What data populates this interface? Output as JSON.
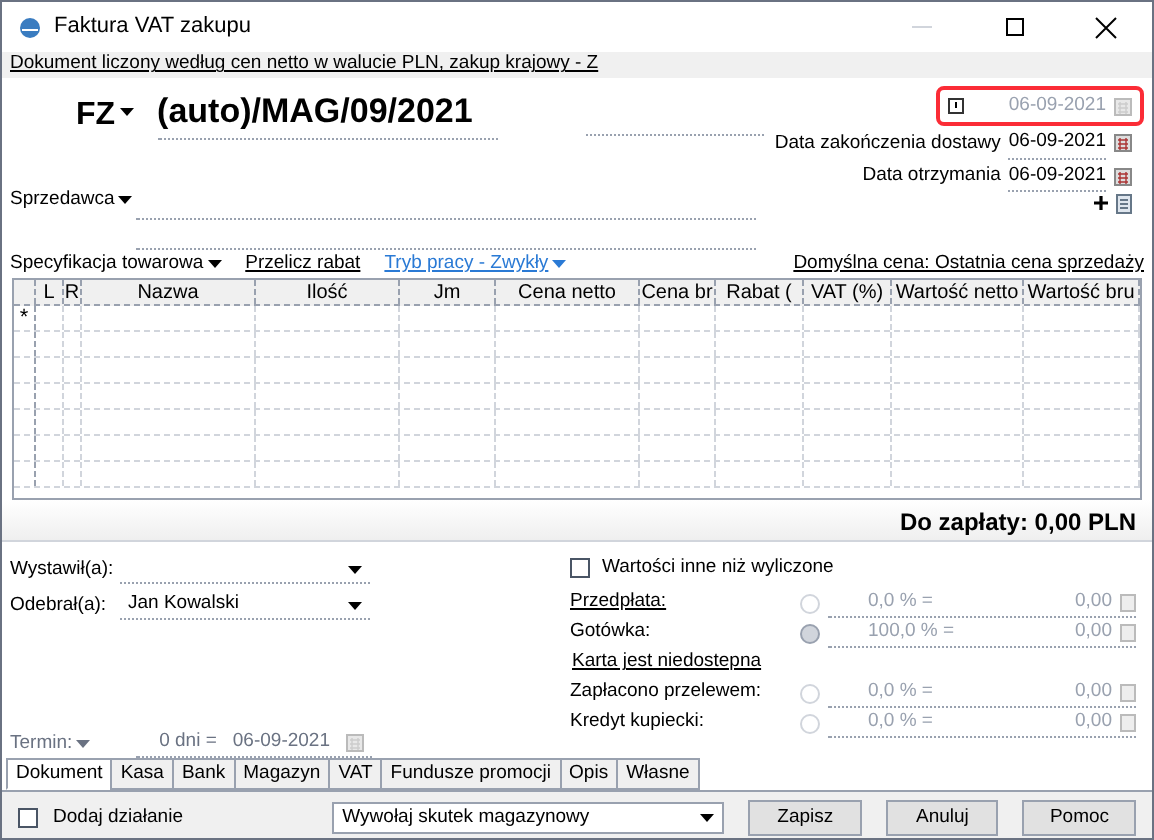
{
  "window": {
    "title": "Faktura VAT zakupu"
  },
  "info_link": "Dokument liczony według cen netto w walucie PLN, zakup krajowy - Z",
  "header": {
    "doc_type": "FZ",
    "number": "(auto)/MAG/09/2021",
    "issue_date": {
      "value": "06-09-2021",
      "disabled": true,
      "highlighted": true
    },
    "dates": [
      {
        "label": "Data zakończenia dostawy",
        "value": "06-09-2021"
      },
      {
        "label": "Data otrzymania",
        "value": "06-09-2021"
      }
    ],
    "seller_label": "Sprzedawca"
  },
  "toolbar": {
    "spec": "Specyfikacja towarowa",
    "recalc": "Przelicz rabat",
    "mode": "Tryb pracy - Zwykły",
    "default_price": "Domyślna cena: Ostatnia cena sprzedaży"
  },
  "table": {
    "columns": [
      "L",
      "R",
      "Nazwa",
      "Ilość",
      "Jm",
      "Cena netto",
      "Cena br",
      "Rabat (",
      "VAT (%)",
      "Wartość netto",
      "Wartość bru"
    ],
    "new_row_marker": "*"
  },
  "total": "Do zapłaty: 0,00 PLN",
  "people": [
    {
      "label": "Wystawił(a):"
    },
    {
      "label": "Odebrał(a):",
      "value": "Jan Kowalski"
    }
  ],
  "term": {
    "label": "Termin:",
    "days": "0 dni =",
    "date": "06-09-2021"
  },
  "other_values": {
    "label": "Wartości inne niż wyliczone",
    "checked": false
  },
  "payments": [
    {
      "kind": "payment",
      "label": "Przedpłata:",
      "link": true,
      "selected": false,
      "percent": "0,0 % =",
      "amount": "0,00"
    },
    {
      "kind": "payment",
      "label": "Gotówka:",
      "link": false,
      "selected": true,
      "percent": "100,0 % =",
      "amount": "0,00"
    },
    {
      "kind": "notice",
      "label": "Karta jest niedostepna"
    },
    {
      "kind": "payment",
      "label": "Zapłacono przelewem:",
      "link": false,
      "selected": false,
      "percent": "0,0 % =",
      "amount": "0,00"
    },
    {
      "kind": "payment",
      "label": "Kredyt kupiecki:",
      "link": false,
      "selected": false,
      "percent": "0,0 % =",
      "amount": "0,00"
    }
  ],
  "tabs": [
    {
      "label": "Dokument",
      "selected": true
    },
    {
      "label": "Kasa",
      "selected": false
    },
    {
      "label": "Bank",
      "selected": false
    },
    {
      "label": "Magazyn",
      "selected": false
    },
    {
      "label": "VAT",
      "selected": false
    },
    {
      "label": "Fundusze promocji",
      "selected": false
    },
    {
      "label": "Opis",
      "selected": false
    },
    {
      "label": "Własne",
      "selected": false
    }
  ],
  "footer": {
    "add_action": {
      "label": "Dodaj działanie",
      "checked": false
    },
    "effect": "Wywołaj skutek magazynowy",
    "buttons": [
      "Zapisz",
      "Anuluj",
      "Pomoc"
    ]
  }
}
